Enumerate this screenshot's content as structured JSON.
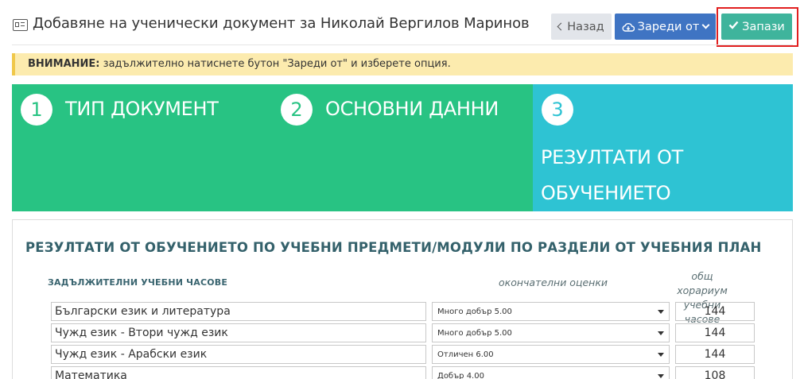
{
  "header": {
    "title": "Добавяне на ученически документ за Николай Вергилов Маринов",
    "title_icon": "id-card-icon",
    "back_label": "Назад",
    "load_label": "Зареди от",
    "save_label": "Запази"
  },
  "alert": {
    "strong": "ВНИМАНИЕ:",
    "text": "задължително натиснете бутон \"Зареди от\" и изберете опция."
  },
  "steps": [
    {
      "number": "1",
      "label": "ТИП ДОКУМЕНТ",
      "color": "#28c383"
    },
    {
      "number": "2",
      "label": "ОСНОВНИ ДАННИ",
      "color": "#28c383"
    },
    {
      "number": "3",
      "label": "РЕЗУЛТАТИ ОТ ОБУЧЕНИЕТО",
      "color": "#2ec3d3"
    }
  ],
  "section": {
    "title": "РЕЗУЛТАТИ ОТ ОБУЧЕНИЕТО ПО УЧЕБНИ ПРЕДМЕТИ/МОДУЛИ ПО РАЗДЕЛИ ОТ УЧЕБНИЯ ПЛАН",
    "col_subjects": "ЗАДЪЛЖИТЕЛНИ УЧЕБНИ ЧАСОВЕ",
    "col_grades": "окончателни оценки",
    "col_hours": "общ хорариум учебни часове"
  },
  "rows": [
    {
      "subject": "Български език и литература",
      "grade": "Много добър 5.00",
      "hours": "144"
    },
    {
      "subject": "Чужд език - Втори чужд език",
      "grade": "Много добър 5.00",
      "hours": "144"
    },
    {
      "subject": "Чужд език - Арабски език",
      "grade": "Отличен 6.00",
      "hours": "144"
    },
    {
      "subject": "Математика",
      "grade": "Добър 4.00",
      "hours": "108"
    }
  ],
  "colors": {
    "save": "#3fb49c",
    "load": "#3f74c3",
    "back": "#e2e5ea",
    "alert": "#fcebae",
    "highlight": "#e11f1f"
  }
}
